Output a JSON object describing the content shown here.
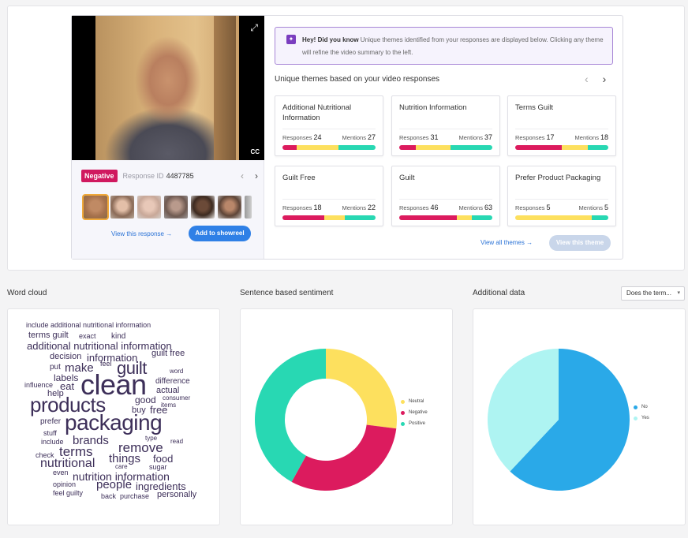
{
  "video_card": {
    "sentiment_badge": "Negative",
    "response_id_label": "Response ID",
    "response_id": "4487785",
    "cc_label": "CC",
    "view_response_link": "View this response →",
    "add_showreel_button": "Add to showreel"
  },
  "tip": {
    "heading": "Hey! Did you know",
    "text": "Unique themes identified from your responses are displayed below. Clicking any theme will refine the video summary to the left."
  },
  "themes": {
    "title": "Unique themes based on your video responses",
    "responses_label": "Responses",
    "mentions_label": "Mentions",
    "items": [
      {
        "name": "Additional Nutritional Information",
        "responses": "24",
        "mentions": "27",
        "sentiment": {
          "negative": 15,
          "neutral": 45,
          "positive": 40
        }
      },
      {
        "name": "Nutrition Information",
        "responses": "31",
        "mentions": "37",
        "sentiment": {
          "negative": 18,
          "neutral": 37,
          "positive": 45
        }
      },
      {
        "name": "Terms Guilt",
        "responses": "17",
        "mentions": "18",
        "sentiment": {
          "negative": 50,
          "neutral": 28,
          "positive": 22
        }
      },
      {
        "name": "Guilt Free",
        "responses": "18",
        "mentions": "22",
        "sentiment": {
          "negative": 45,
          "neutral": 22,
          "positive": 33
        }
      },
      {
        "name": "Guilt",
        "responses": "46",
        "mentions": "63",
        "sentiment": {
          "negative": 62,
          "neutral": 16,
          "positive": 22
        }
      },
      {
        "name": "Prefer Product Packaging",
        "responses": "5",
        "mentions": "5",
        "sentiment": {
          "negative": 0,
          "neutral": 82,
          "positive": 18
        }
      }
    ],
    "view_all_link": "View all themes →",
    "view_theme_button": "View this theme"
  },
  "word_cloud": {
    "title": "Word cloud"
  },
  "sentiment": {
    "title": "Sentence based sentiment",
    "legend": [
      "Neutral",
      "Negative",
      "Positive"
    ]
  },
  "additional": {
    "title": "Additional data",
    "dropdown_value": "Does the term...",
    "legend": [
      "No",
      "Yes"
    ]
  },
  "chart_data": [
    {
      "type": "pie",
      "title": "",
      "variant": "donut",
      "labels": [
        "Neutral",
        "Negative",
        "Positive"
      ],
      "values": [
        27,
        31,
        42
      ],
      "colors": [
        "#fde05e",
        "#dc1b5e",
        "#28d8b3"
      ]
    },
    {
      "type": "pie",
      "title": "",
      "labels": [
        "No",
        "Yes"
      ],
      "values": [
        62,
        38
      ],
      "colors": [
        "#2aa9e8",
        "#aef4f2"
      ]
    }
  ],
  "colors": {
    "negative": "#dc1b5e",
    "neutral": "#fde05e",
    "positive": "#28d8b3",
    "accent": "#2f80e6",
    "wordcloud_text": "#3d2f59"
  },
  "wordcloud_words": [
    "include additional nutritional information",
    "terms guilt",
    "exact",
    "kind",
    "additional nutritional information",
    "decision",
    "information",
    "guilt free",
    "put",
    "make",
    "guilt",
    "feel",
    "word",
    "labels",
    "difference",
    "influence",
    "eat",
    "clean",
    "actual",
    "help",
    "consumer",
    "good",
    "items",
    "products",
    "buy",
    "free",
    "prefer",
    "packaging",
    "stuff",
    "type",
    "include",
    "brands",
    "read",
    "remove",
    "check",
    "terms",
    "things",
    "food",
    "nutritional",
    "care",
    "sugar",
    "even",
    "nutrition information",
    "opinion",
    "people",
    "ingredients",
    "feel guilty",
    "back",
    "purchase",
    "personally"
  ]
}
